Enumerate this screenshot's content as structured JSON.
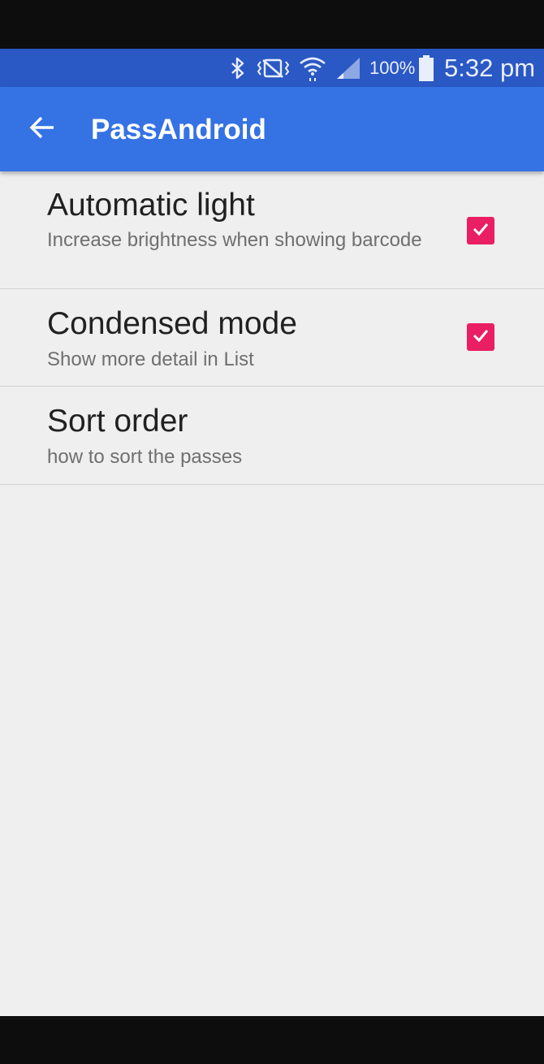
{
  "status_bar": {
    "battery_percent": "100%",
    "time": "5:32 pm",
    "icons": [
      "bluetooth-icon",
      "vibrate-icon",
      "wifi-icon",
      "signal-icon",
      "battery-icon"
    ]
  },
  "app_bar": {
    "title": "PassAndroid",
    "back_icon": "arrow-left-icon",
    "color": "#3572e4"
  },
  "preferences": [
    {
      "title": "Automatic light",
      "summary": "Increase brightness when showing barcode",
      "checked": true
    },
    {
      "title": "Condensed mode",
      "summary": "Show more detail in List",
      "checked": true
    },
    {
      "title": "Sort order",
      "summary": "how to sort the passes"
    }
  ],
  "colors": {
    "status_bar": "#2a58c4",
    "accent": "#e91e63",
    "background": "#efefef"
  }
}
